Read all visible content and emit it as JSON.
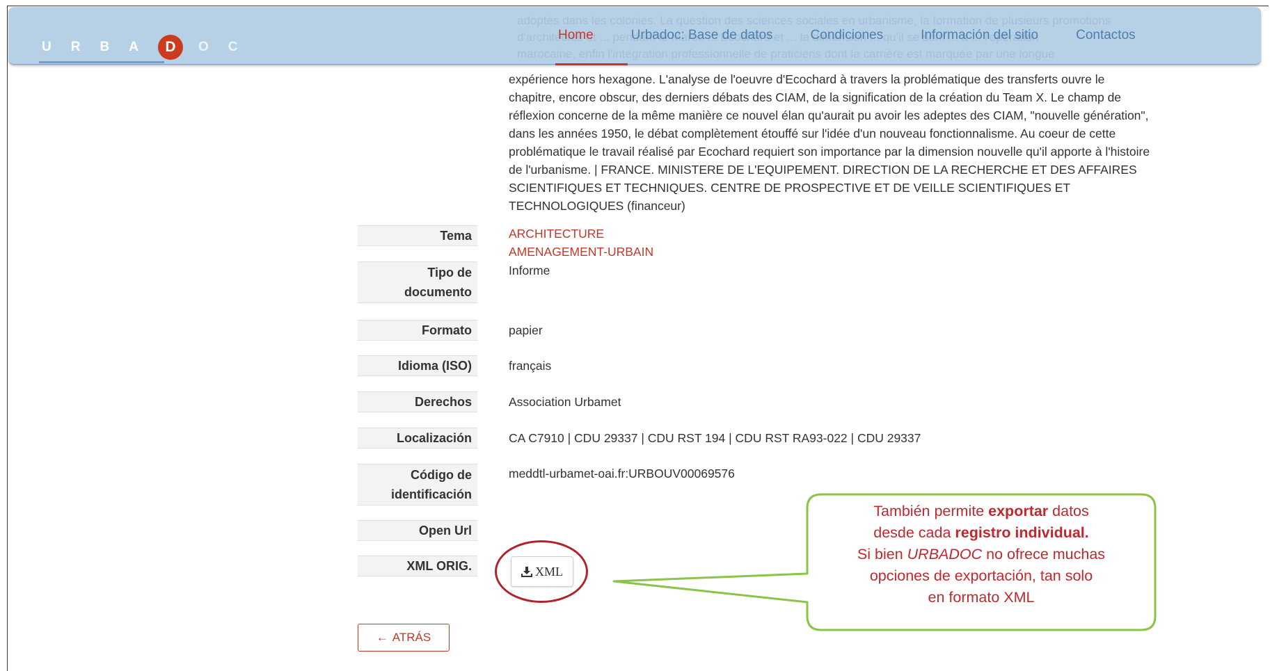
{
  "navbar": {
    "logo_letters": [
      "U",
      "R",
      "B",
      "A",
      "D",
      "O",
      "C"
    ],
    "links": [
      {
        "label": "Home",
        "active": true
      },
      {
        "label": "Urbadoc: Base de datos",
        "active": false
      },
      {
        "label": "Condiciones",
        "active": false
      },
      {
        "label": "Información del sitio",
        "active": false
      },
      {
        "label": "Contactos",
        "active": false
      }
    ],
    "ghost_lines": [
      "adoptés dans les colonies. La question des sciences sociales en urbanisme, la formation de plusieurs promotions",
      "d'architectes et ... pendant le Maroc ... Ecochard et ... la dimension ... qu'il se sont ... à ... l'opération",
      "marocaine, enfin l'intégration professionnelle de praticiens dont la carrière est marquée par une longue"
    ]
  },
  "record": {
    "description_lines": [
      "expérience hors hexagone. L'analyse de l'oeuvre d'Ecochard à travers la problématique des transferts ouvre le",
      "chapitre, encore obscur, des derniers débats des CIAM, de la signification de la création du Team X. Le champ de",
      "réflexion concerne de la même manière ce nouvel élan qu'aurait pu avoir les adeptes des CIAM, \"nouvelle génération\",",
      "dans les années 1950, le débat complètement étouffé sur l'idée d'un nouveau fonctionnalisme. Au coeur de cette",
      "problématique le travail réalisé par Ecochard requiert son importance par la dimension nouvelle qu'il apporte à l'histoire",
      "de l'urbanisme. | FRANCE. MINISTERE DE L'EQUIPEMENT. DIRECTION DE LA RECHERCHE ET DES AFFAIRES",
      "SCIENTIFIQUES ET TECHNIQUES. CENTRE DE PROSPECTIVE ET DE VEILLE SCIENTIFIQUES ET",
      "TECHNOLOGIQUES (financeur)"
    ],
    "fields": {
      "tema": {
        "label": "Tema",
        "values": [
          "ARCHITECTURE",
          "AMENAGEMENT-URBAIN"
        ]
      },
      "tipo": {
        "label_line1": "Tipo de",
        "label_line2": "documento",
        "value": "Informe"
      },
      "formato": {
        "label": "Formato",
        "value": "papier"
      },
      "idioma": {
        "label": "Idioma (ISO)",
        "value": "français"
      },
      "derechos": {
        "label": "Derechos",
        "value": "Association Urbamet"
      },
      "localizacion": {
        "label": "Localización",
        "value": "CA C7910 | CDU 29337 | CDU RST 194 | CDU RST RA93-022 | CDU 29337"
      },
      "codigo": {
        "label_line1": "Código de",
        "label_line2": "identificación",
        "value": "meddtl-urbamet-oai.fr:URBOUV00069576"
      },
      "openurl": {
        "label": "Open Url",
        "value": ""
      },
      "xml": {
        "label": "XML ORIG.",
        "button_label": "XML"
      }
    },
    "back_label": "ATRÁS"
  },
  "callout": {
    "line1_pre": "También permite ",
    "line1_bold": "exportar",
    "line1_post": " datos",
    "line2_pre": "desde cada ",
    "line2_bold": "registro individual.",
    "line3_pre": "Si bien ",
    "line3_italic": "URBADOC",
    "line3_post": " no ofrece muchas",
    "line4": "opciones de exportación, tan solo",
    "line5": "en formato XML",
    "border_color": "#8cc34a",
    "text_color": "#c0282d",
    "ring_color": "#b0232a"
  },
  "colors": {
    "navbar_bg": "#b6d0e6",
    "link": "#4a7fae",
    "accent": "#c0392b",
    "logo_circle": "#cc3b1e"
  }
}
